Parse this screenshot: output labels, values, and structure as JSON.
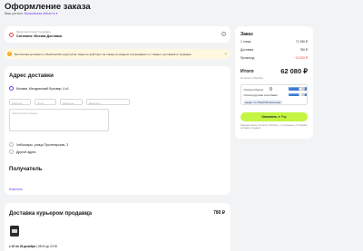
{
  "header": {
    "title": "Оформление заказа",
    "region_label": "Ваш регион:",
    "region_value": "Московская область"
  },
  "seller": {
    "caption": "Заказ выполняет продавец",
    "name": "Ситилинк: Москва Доставка"
  },
  "warning": {
    "text": "Бесплатная доставка со СберСпасибо недоступна. Акция не действует на товары из раздела «Супермаркет» и товары с доставкой от продавца"
  },
  "address": {
    "heading": "Адрес доставки",
    "selected": "Москва, Мичуринский бульвар, 4 к1",
    "fields": [
      "Подъезд",
      "Этаж",
      "Квартира",
      "Домофон"
    ],
    "comment_placeholder": "Комментарий курьеру",
    "alt_address": "Чебоксары, улица Пролетарская, 3",
    "other_address": "Другой адрес",
    "recipient_heading": "Получатель",
    "change_link": "Изменить"
  },
  "delivery": {
    "heading": "Доставка курьером продавца",
    "price": "780 ₽",
    "date": "с 22 по 26 декабря",
    "time": "08:00 до 22:00"
  },
  "order": {
    "heading": "Заказ",
    "rows": [
      {
        "label": "1 товар",
        "value": "71 286 ₽"
      },
      {
        "label": "Доставка",
        "value": "780 ₽"
      },
      {
        "label": "Промокод",
        "value": "−10 000 ₽"
      }
    ],
    "total_label": "Итого",
    "total_value": "62 080 ₽",
    "sber_note": "Оплата по SberPay",
    "pay_options": [
      {
        "label": "Оплата Сбером",
        "badge": "до 35% Спасибо"
      },
      {
        "label": "Оплата другими способами",
        "badge": "до 10% Спасибо"
      }
    ],
    "credit_note": "кредит по СберПэй включены",
    "pay_button": "Оплатить",
    "pay_button_suffix": "Pay",
    "legal_note": "Нажимая кнопку «Оплатить SberPay», я соглашаюсь с Условиями доставки и продажи"
  },
  "colors": {
    "accent": "#7a3cf0",
    "cta": "#c4f542",
    "warning_bg": "#fff8e1",
    "promo": "#e8433b"
  }
}
